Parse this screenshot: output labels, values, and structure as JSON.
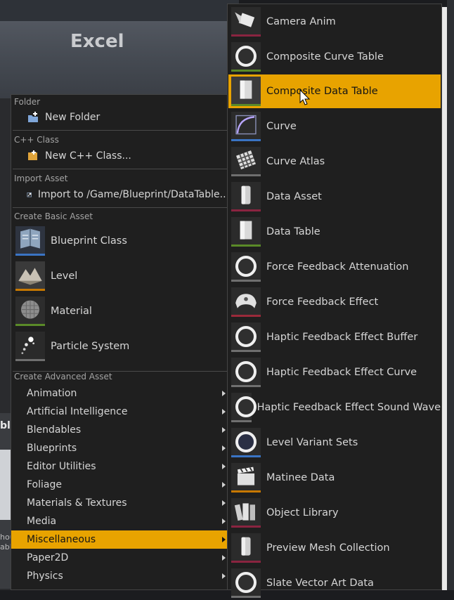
{
  "background": {
    "title": "Excel",
    "left_fragment_top": "bl",
    "left_fragment_bottom": "hou\nabl"
  },
  "left_menu": {
    "sections": [
      {
        "header": "Folder",
        "items": [
          {
            "label": "New Folder",
            "icon": "new-folder-icon"
          }
        ]
      },
      {
        "header": "C++ Class",
        "items": [
          {
            "label": "New C++ Class...",
            "icon": "cpp-class-icon"
          }
        ]
      },
      {
        "header": "Import Asset",
        "items": [
          {
            "label": "Import to /Game/Blueprint/DataTable...",
            "icon": "import-icon"
          }
        ]
      }
    ],
    "basic_header": "Create Basic Asset",
    "basic_assets": [
      {
        "label": "Blueprint Class",
        "icon": "blueprint-class-icon",
        "color": "#3a74c4"
      },
      {
        "label": "Level",
        "icon": "level-icon",
        "color": "#c77800"
      },
      {
        "label": "Material",
        "icon": "material-icon",
        "color": "#5a8a28"
      },
      {
        "label": "Particle System",
        "icon": "particle-system-icon",
        "color": "#6f6f6f"
      }
    ],
    "advanced_header": "Create Advanced Asset",
    "advanced_categories": [
      "Animation",
      "Artificial Intelligence",
      "Blendables",
      "Blueprints",
      "Editor Utilities",
      "Foliage",
      "Materials & Textures",
      "Media",
      "Miscellaneous",
      "Paper2D",
      "Physics"
    ],
    "active_category": "Miscellaneous"
  },
  "submenu": {
    "items": [
      {
        "label": "Camera Anim",
        "icon": "camera-anim-icon"
      },
      {
        "label": "Composite Curve Table",
        "icon": "composite-curve-table-icon"
      },
      {
        "label": "Composite Data Table",
        "icon": "composite-data-table-icon"
      },
      {
        "label": "Curve",
        "icon": "curve-icon"
      },
      {
        "label": "Curve Atlas",
        "icon": "curve-atlas-icon"
      },
      {
        "label": "Data Asset",
        "icon": "data-asset-icon"
      },
      {
        "label": "Data Table",
        "icon": "data-table-icon"
      },
      {
        "label": "Force Feedback Attenuation",
        "icon": "force-feedback-attenuation-icon"
      },
      {
        "label": "Force Feedback Effect",
        "icon": "force-feedback-effect-icon"
      },
      {
        "label": "Haptic Feedback Effect Buffer",
        "icon": "haptic-buffer-icon"
      },
      {
        "label": "Haptic Feedback Effect Curve",
        "icon": "haptic-curve-icon"
      },
      {
        "label": "Haptic Feedback Effect Sound Wave",
        "icon": "haptic-sound-wave-icon"
      },
      {
        "label": "Level Variant Sets",
        "icon": "level-variant-sets-icon"
      },
      {
        "label": "Matinee Data",
        "icon": "matinee-data-icon"
      },
      {
        "label": "Object Library",
        "icon": "object-library-icon"
      },
      {
        "label": "Preview Mesh Collection",
        "icon": "preview-mesh-collection-icon"
      },
      {
        "label": "Slate Vector Art Data",
        "icon": "slate-vector-art-icon"
      }
    ],
    "active_item": "Composite Data Table"
  },
  "colors": {
    "highlight": "#e8a300",
    "menu_bg": "#1f1f1f"
  }
}
